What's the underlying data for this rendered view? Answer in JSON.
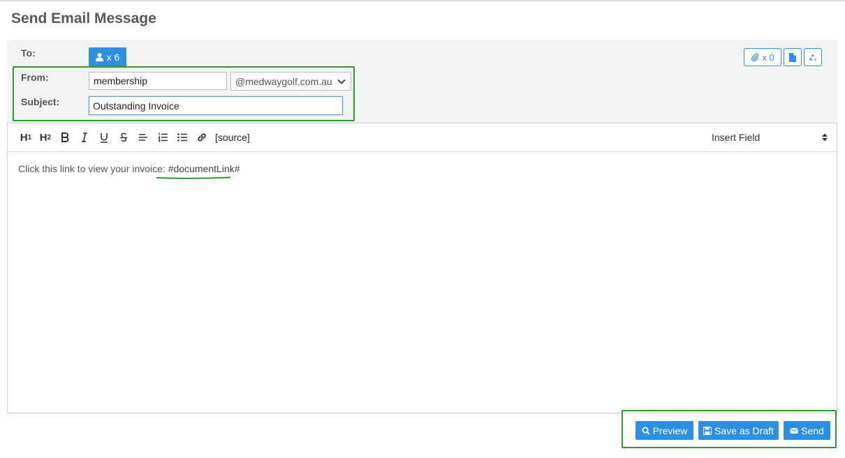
{
  "page": {
    "title": "Send Email Message"
  },
  "header": {
    "to_label": "To:",
    "from_label": "From:",
    "subject_label": "Subject:",
    "recipient_count": "x 6",
    "from_value": "membership",
    "domain_value": "@medwaygolf.com.au",
    "subject_value": "Outstanding Invoice",
    "attachment_count": "x 0"
  },
  "toolbar": {
    "h1": "H",
    "h1_sub": "1",
    "h2": "H",
    "h2_sub": "2",
    "source": "[source]",
    "insert_field": "Insert Field"
  },
  "body": {
    "text": "Click this link to view your invoice: ",
    "link": "#documentLink#"
  },
  "actions": {
    "preview": "Preview",
    "save_draft": "Save as Draft",
    "send": "Send"
  },
  "colors": {
    "primary": "#2e8fe0",
    "highlight": "#2e9a2e"
  }
}
